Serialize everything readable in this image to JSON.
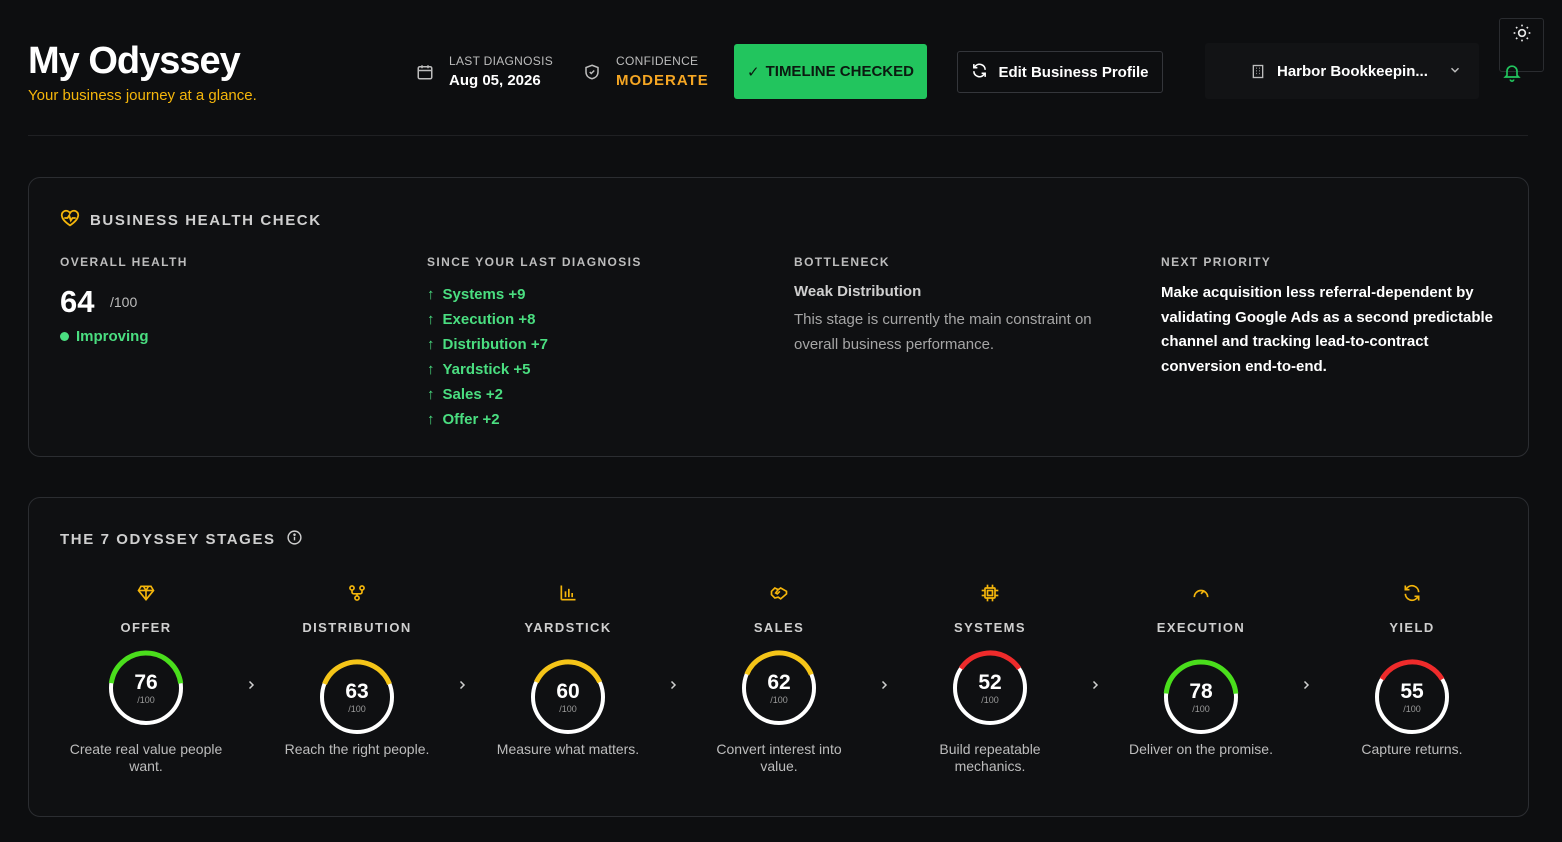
{
  "header": {
    "title": "My Odyssey",
    "subtitle": "Your business journey at a glance.",
    "last_diagnosis_label": "LAST DIAGNOSIS",
    "last_diagnosis_value": "Aug 05, 2026",
    "confidence_label": "CONFIDENCE",
    "confidence_value": "MODERATE",
    "timeline_button": "TIMELINE CHECKED",
    "edit_button": "Edit Business Profile",
    "business_name": "Harbor Bookkeepin..."
  },
  "health": {
    "title": "BUSINESS HEALTH CHECK",
    "overall_label": "OVERALL HEALTH",
    "score": "64",
    "score_max": "/100",
    "trend": "Improving",
    "since_label": "SINCE YOUR LAST DIAGNOSIS",
    "changes": [
      "Systems +9",
      "Execution +8",
      "Distribution +7",
      "Yardstick +5",
      "Sales +2",
      "Offer +2"
    ],
    "bottleneck_label": "BOTTLENECK",
    "bottleneck_name": "Weak Distribution",
    "bottleneck_desc": "This stage is currently the main constraint on overall business performance.",
    "priority_label": "NEXT PRIORITY",
    "priority_text": "Make acquisition less referral-dependent by validating Google Ads as a second predictable channel and tracking lead-to-contract conversion end-to-end."
  },
  "stages": {
    "title": "THE 7 ODYSSEY STAGES",
    "items": [
      {
        "name": "OFFER",
        "score": 76,
        "max": "/100",
        "desc": "Create real value people want.",
        "icon": "diamond-icon",
        "color": "#4ade1c"
      },
      {
        "name": "DISTRIBUTION",
        "score": 63,
        "max": "/100",
        "desc": "Reach the right people.",
        "icon": "network-icon",
        "color": "#f5c518"
      },
      {
        "name": "YARDSTICK",
        "score": 60,
        "max": "/100",
        "desc": "Measure what matters.",
        "icon": "bar-chart-icon",
        "color": "#f5c518"
      },
      {
        "name": "SALES",
        "score": 62,
        "max": "/100",
        "desc": "Convert interest into value.",
        "icon": "handshake-icon",
        "color": "#f5c518"
      },
      {
        "name": "SYSTEMS",
        "score": 52,
        "max": "/100",
        "desc": "Build repeatable mechanics.",
        "icon": "chip-icon",
        "color": "#ef2b2b"
      },
      {
        "name": "EXECUTION",
        "score": 78,
        "max": "/100",
        "desc": "Deliver on the promise.",
        "icon": "gauge-icon",
        "color": "#4ade1c"
      },
      {
        "name": "YIELD",
        "score": 55,
        "max": "/100",
        "desc": "Capture returns.",
        "icon": "refresh-icon",
        "color": "#ef2b2b"
      }
    ]
  },
  "colors": {
    "accent": "#f5b60b",
    "green": "#22c55e",
    "orange": "#f5a623"
  }
}
